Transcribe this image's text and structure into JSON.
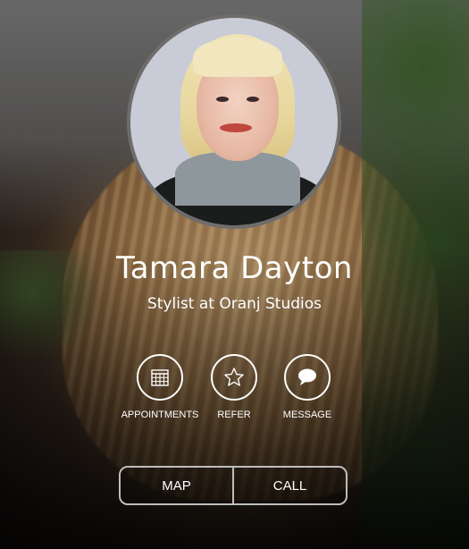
{
  "profile": {
    "name": "Tamara Dayton",
    "title": "Stylist at Oranj Studios"
  },
  "actions": [
    {
      "label": "APPOINTMENTS",
      "icon": "calendar-icon"
    },
    {
      "label": "REFER",
      "icon": "star-icon"
    },
    {
      "label": "MESSAGE",
      "icon": "speech-bubble-icon"
    }
  ],
  "bottom_buttons": {
    "map": "MAP",
    "call": "CALL"
  },
  "colors": {
    "text": "#ffffff",
    "button_border": "#bdbdbd",
    "avatar_border": "#6f6d6b"
  }
}
